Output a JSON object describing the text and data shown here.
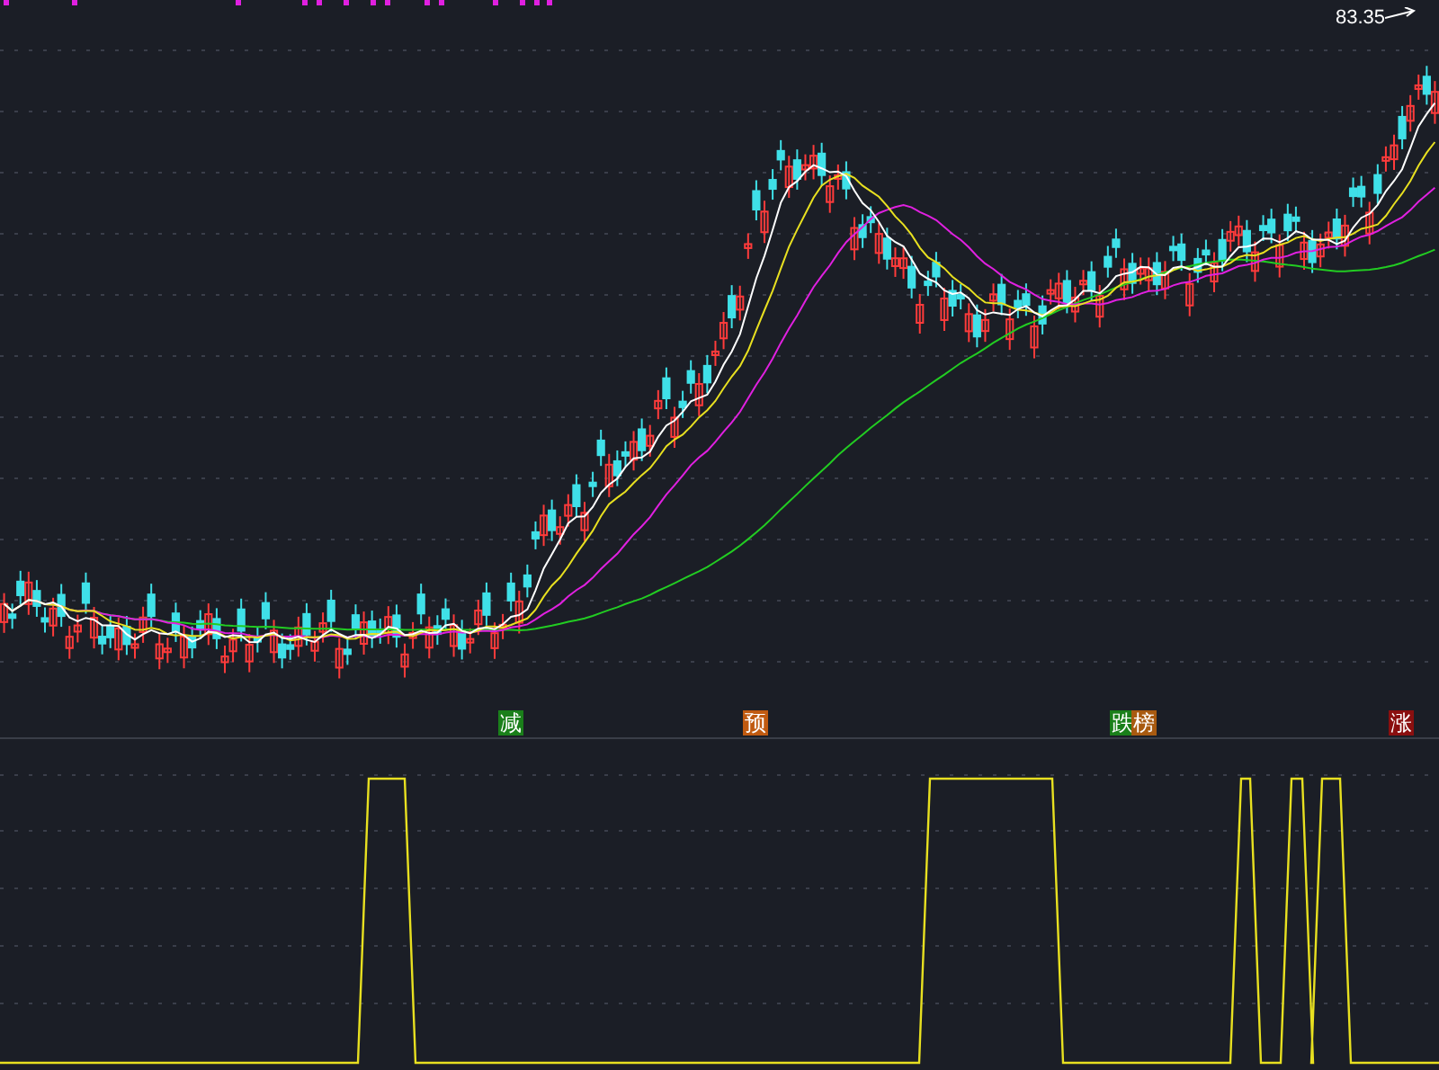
{
  "price_label": "83.35",
  "signals": [
    {
      "text": "减",
      "color": "#1a7f1a"
    },
    {
      "text": "预",
      "color": "#c05a10"
    },
    {
      "text": "跌",
      "color": "#1a7f1a"
    },
    {
      "text": "榜",
      "color": "#a85a10"
    },
    {
      "text": "涨",
      "color": "#8a0f0f"
    }
  ]
}
